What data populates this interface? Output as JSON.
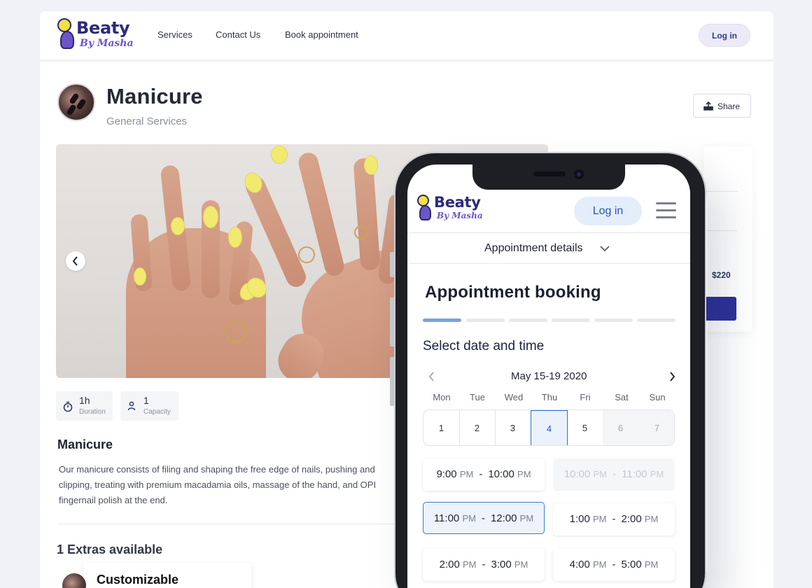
{
  "desktop": {
    "logo": {
      "brand": "Beaty",
      "sub": "By Masha"
    },
    "nav": [
      "Services",
      "Contact Us",
      "Book appointment"
    ],
    "login_label": "Log in",
    "service": {
      "title": "Manicure",
      "category": "General Services",
      "share_label": "Share"
    },
    "stats": [
      {
        "value": "1h",
        "label": "Duration",
        "icon": "stopwatch-icon"
      },
      {
        "value": "1",
        "label": "Capacity",
        "icon": "person-icon"
      }
    ],
    "description": {
      "title": "Manicure",
      "lines": [
        "Our manicure consists of filing and shaping the free edge of nails, pushing and",
        "clipping, treating with premium macadamia oils, massage of the hand, and OPI",
        "fingernail polish at the end."
      ]
    },
    "extras": {
      "title": "1 Extras available",
      "items": [
        {
          "name": "Customizable"
        }
      ]
    },
    "side_price": "$220"
  },
  "mobile": {
    "logo": {
      "brand": "Beaty",
      "sub": "By Masha"
    },
    "login_label": "Log in",
    "details_label": "Appointment details",
    "booking_title": "Appointment booking",
    "steps_total": 6,
    "steps_active": 1,
    "select_label": "Select date  and time",
    "date_range": "May 15-19 2020",
    "weekdays": [
      "Mon",
      "Tue",
      "Wed",
      "Thu",
      "Fri",
      "Sat",
      "Sun"
    ],
    "days": [
      {
        "label": "1",
        "state": "normal"
      },
      {
        "label": "2",
        "state": "normal"
      },
      {
        "label": "3",
        "state": "normal"
      },
      {
        "label": "4",
        "state": "selected"
      },
      {
        "label": "5",
        "state": "normal"
      },
      {
        "label": "6",
        "state": "disabled"
      },
      {
        "label": "7",
        "state": "disabled"
      }
    ],
    "slots": [
      {
        "start": "9:00",
        "start_ampm": "PM",
        "end": "10:00",
        "end_ampm": "PM",
        "state": "normal"
      },
      {
        "start": "10:00",
        "start_ampm": "PM",
        "end": "11:00",
        "end_ampm": "PM",
        "state": "disabled"
      },
      {
        "start": "11:00",
        "start_ampm": "PM",
        "end": "12:00",
        "end_ampm": "PM",
        "state": "selected"
      },
      {
        "start": "1:00",
        "start_ampm": "PM",
        "end": "2:00",
        "end_ampm": "PM",
        "state": "normal"
      },
      {
        "start": "2:00",
        "start_ampm": "PM",
        "end": "3:00",
        "end_ampm": "PM",
        "state": "normal"
      },
      {
        "start": "4:00",
        "start_ampm": "PM",
        "end": "5:00",
        "end_ampm": "PM",
        "state": "normal"
      }
    ]
  },
  "colors": {
    "brand": "#2d2a7a",
    "accent": "#2558b8",
    "step_active": "#7aa3e0",
    "nail_polish": "#f2ea6e"
  }
}
